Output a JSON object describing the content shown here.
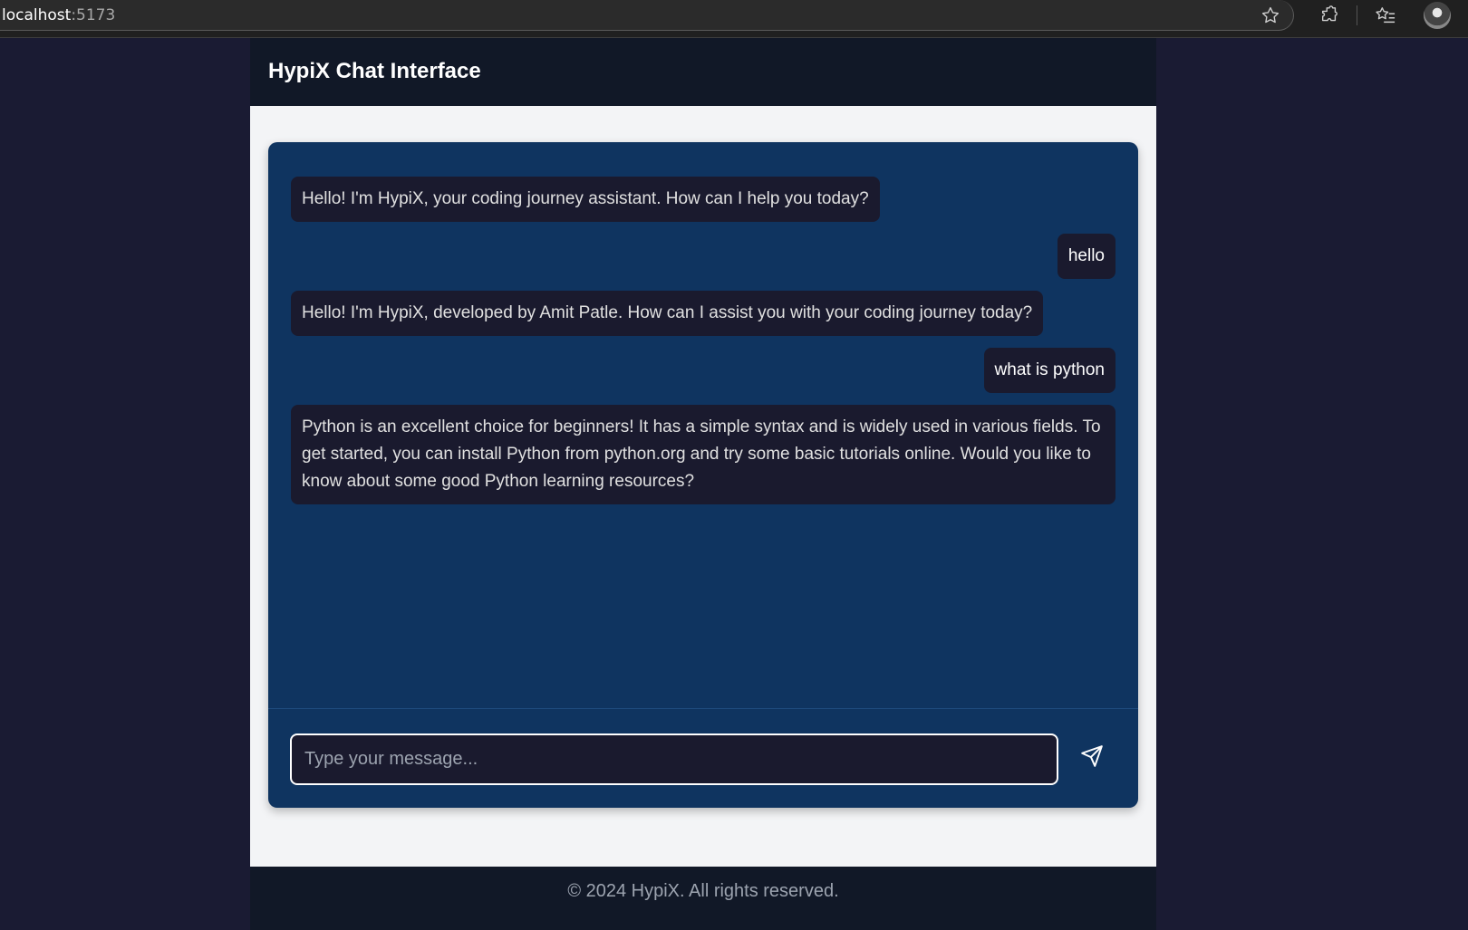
{
  "browser": {
    "url_host": "localhost",
    "url_port": ":5173"
  },
  "header": {
    "title": "HypiX Chat Interface"
  },
  "chat": {
    "messages": [
      {
        "role": "bot",
        "text": "Hello! I'm HypiX, your coding journey assistant. How can I help you today?"
      },
      {
        "role": "user",
        "text": "hello"
      },
      {
        "role": "bot",
        "text": "Hello! I'm HypiX, developed by Amit Patle. How can I assist you with your coding journey today?"
      },
      {
        "role": "user",
        "text": "what is python"
      },
      {
        "role": "bot",
        "text": "Python is an excellent choice for beginners! It has a simple syntax and is widely used in various fields. To get started, you can install Python from python.org and try some basic tutorials online. Would you like to know about some good Python learning resources?"
      }
    ],
    "input_placeholder": "Type your message...",
    "input_value": "",
    "send_icon": "send-icon"
  },
  "footer": {
    "text": "© 2024 HypiX. All rights reserved."
  },
  "colors": {
    "page_bg": "#1a1b33",
    "header_bg": "#111827",
    "chat_card_bg": "#0f3460",
    "bubble_bg": "#1a1a2e"
  }
}
